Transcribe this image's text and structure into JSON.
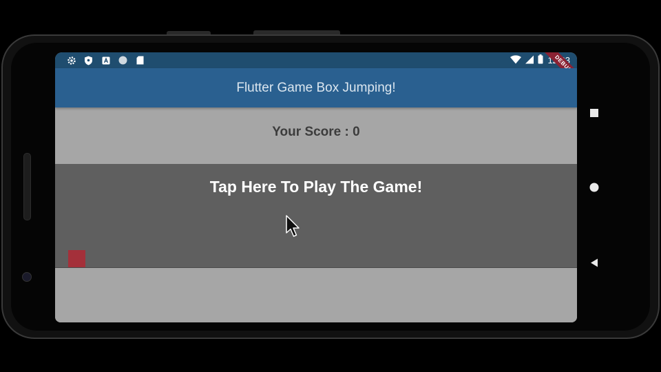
{
  "status_bar": {
    "time": "12:23",
    "left_icons": [
      "settings-icon",
      "shield-icon",
      "a-notification-icon",
      "circle-icon",
      "sd-card-icon"
    ],
    "right_icons": [
      "wifi-icon",
      "signal-icon",
      "battery-icon"
    ]
  },
  "debug_banner": "DEBUG",
  "app_bar": {
    "title": "Flutter Game Box Jumping!"
  },
  "score": {
    "label": "Your Score : 0"
  },
  "game": {
    "play_prompt": "Tap Here To Play The Game!",
    "player_color": "#a4303a",
    "area_color": "#5f5f5f"
  },
  "nav_bar": {
    "buttons": [
      "recents-icon",
      "home-icon",
      "back-icon"
    ]
  },
  "colors": {
    "app_bar": "#2a6090",
    "status_bar": "#1f4d6f",
    "background": "#a6a6a6"
  }
}
